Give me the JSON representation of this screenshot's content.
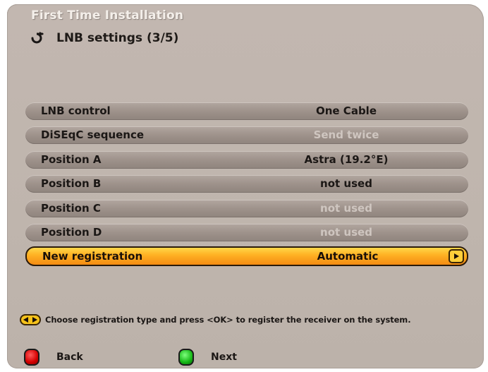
{
  "header": {
    "title": "First Time Installation",
    "subtitle": "LNB settings (3/5)"
  },
  "menu": {
    "rows": [
      {
        "label": "LNB control",
        "value": "One Cable",
        "dim": false
      },
      {
        "label": "DiSEqC sequence",
        "value": "Send twice",
        "dim": true
      },
      {
        "label": "Position A",
        "value": "Astra (19.2°E)",
        "dim": false
      },
      {
        "label": "Position B",
        "value": "not used",
        "dim": false
      },
      {
        "label": "Position C",
        "value": "not used",
        "dim": true
      },
      {
        "label": "Position D",
        "value": "not used",
        "dim": true
      },
      {
        "label": "New registration",
        "value": "Automatic",
        "selected": true
      }
    ]
  },
  "hint": {
    "text": "Choose registration type and press <OK> to register the receiver on the system."
  },
  "footer": {
    "back_label": "Back",
    "next_label": "Next"
  },
  "colors": {
    "panel": "#c2b7b0",
    "selection": "#ffb325",
    "red_key": "#d40000",
    "green_key": "#17b817"
  }
}
